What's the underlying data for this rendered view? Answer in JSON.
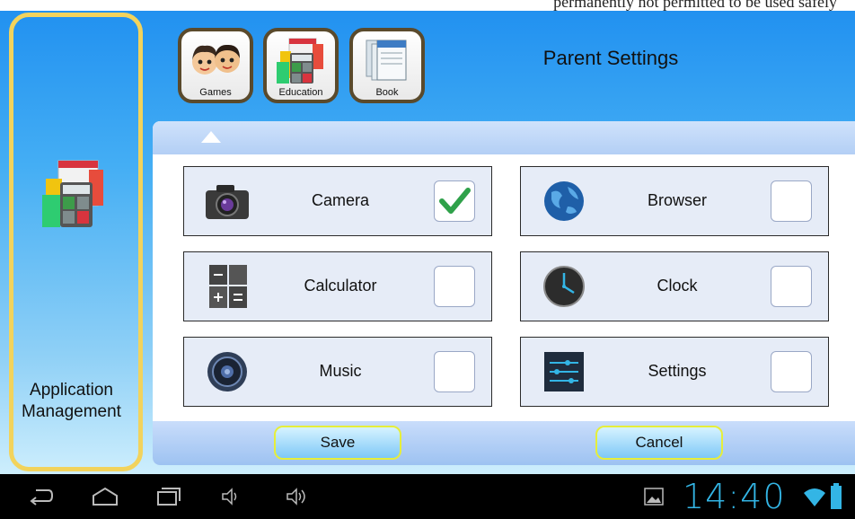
{
  "header": {
    "title": "Parent Settings",
    "top_strip_text": "permanently not permitted to be used safely"
  },
  "sidebar": {
    "label_line1": "Application",
    "label_line2": "Management",
    "icon": "education-apps-icon"
  },
  "tabs": [
    {
      "label": "Games",
      "icon": "kids-faces-icon"
    },
    {
      "label": "Education",
      "icon": "education-apps-icon"
    },
    {
      "label": "Book",
      "icon": "books-icon"
    }
  ],
  "apps": [
    {
      "label": "Camera",
      "icon": "camera-icon",
      "checked": true
    },
    {
      "label": "Browser",
      "icon": "globe-icon",
      "checked": false
    },
    {
      "label": "Calculator",
      "icon": "calculator-icon",
      "checked": false
    },
    {
      "label": "Clock",
      "icon": "clock-icon",
      "checked": false
    },
    {
      "label": "Music",
      "icon": "speaker-icon",
      "checked": false
    },
    {
      "label": "Settings",
      "icon": "sliders-icon",
      "checked": false
    }
  ],
  "buttons": {
    "save": "Save",
    "cancel": "Cancel"
  },
  "status": {
    "time": "14:40"
  },
  "colors": {
    "accent": "#33b5e5",
    "sidebar_border": "#f2d35c",
    "button_border": "#e6ee3a"
  }
}
